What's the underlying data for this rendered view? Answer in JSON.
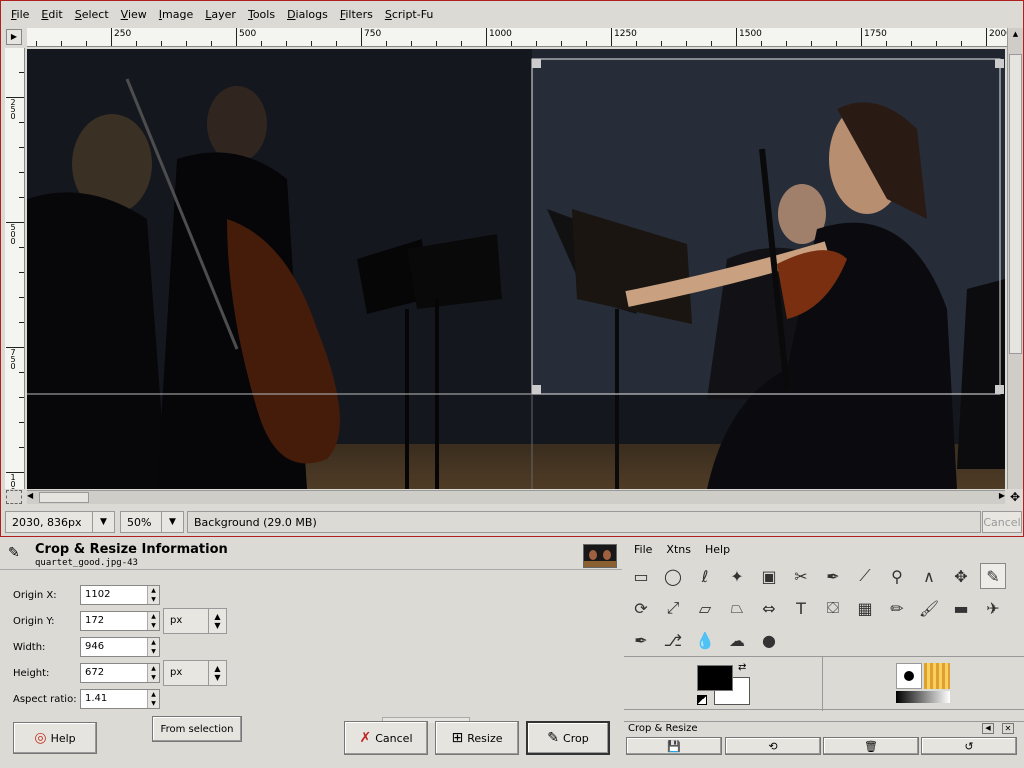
{
  "image_window": {
    "menus": [
      "File",
      "Edit",
      "Select",
      "View",
      "Image",
      "Layer",
      "Tools",
      "Dialogs",
      "Filters",
      "Script-Fu"
    ],
    "hruler_labels": [
      "250",
      "500",
      "750",
      "1000",
      "1250",
      "1500",
      "1750",
      "2000"
    ],
    "vruler_labels": [
      "250",
      "500",
      "750",
      "1000"
    ],
    "status": {
      "coords": "2030, 836",
      "unit": "px",
      "zoom": "50%",
      "layer_info": "Background (29.0 MB)",
      "cancel_label": "Cancel"
    }
  },
  "dialog": {
    "title": "Crop & Resize Information",
    "subtitle": "quartet_good.jpg-43",
    "fields": {
      "origin_x_label": "Origin X:",
      "origin_x": "1102",
      "origin_y_label": "Origin Y:",
      "origin_y": "172",
      "width_label": "Width:",
      "width": "946",
      "height_label": "Height:",
      "height": "672",
      "aspect_label": "Aspect ratio:",
      "aspect": "1.41",
      "unit_1": "px",
      "unit_2": "px"
    },
    "buttons": {
      "from_selection": "From selection",
      "help": "Help",
      "cancel": "Cancel",
      "resize": "Resize",
      "crop": "Crop"
    }
  },
  "toolbox": {
    "menus": [
      "File",
      "Xtns",
      "Help"
    ],
    "tool_options_title": "Crop & Resize",
    "tools": [
      "rect-select",
      "ellipse-select",
      "free-select",
      "fuzzy-select",
      "color-select",
      "scissors",
      "paths",
      "color-picker",
      "zoom",
      "measure",
      "move",
      "crop",
      "transform",
      "scale",
      "shear",
      "perspective",
      "flip",
      "text",
      "bucket-fill",
      "blend",
      "pencil",
      "paintbrush",
      "eraser",
      "airbrush",
      "ink",
      "clone",
      "convolve",
      "smudge",
      "dodge-burn"
    ]
  },
  "colors": {
    "fg": "#000000",
    "bg": "#ffffff",
    "window_border": "#b02020"
  }
}
